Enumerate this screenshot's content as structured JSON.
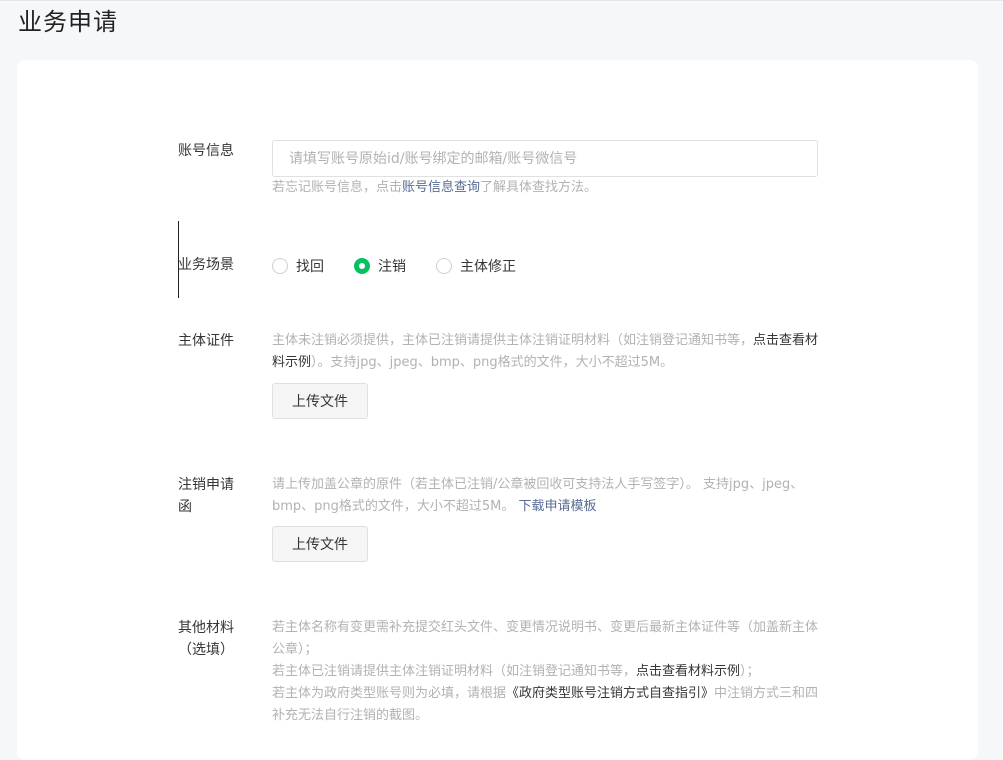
{
  "page": {
    "title": "业务申请"
  },
  "account": {
    "label": "账号信息",
    "placeholder": "请填写账号原始id/账号绑定的邮箱/账号微信号",
    "hint_pre": "若忘记账号信息，点击",
    "hint_link": "账号信息查询",
    "hint_post": "了解具体查找方法。"
  },
  "scene": {
    "label": "业务场景",
    "options": [
      "找回",
      "注销",
      "主体修正"
    ],
    "selected": "注销"
  },
  "cert": {
    "label": "主体证件",
    "desc_pre": "主体未注销必须提供，主体已注销请提供主体注销证明材料（如注销登记通知书等，",
    "desc_link": "点击查看材料示例",
    "desc_post": "）。支持jpg、jpeg、bmp、png格式的文件，大小不超过5M。",
    "upload_label": "上传文件"
  },
  "letter": {
    "label_line1": "注销申请",
    "label_line2": "函",
    "desc": "请上传加盖公章的原件（若主体已注销/公章被回收可支持法人手写签字）。 支持jpg、jpeg、bmp、png格式的文件，大小不超过5M。",
    "desc_link": "下载申请模板",
    "upload_label": "上传文件"
  },
  "other": {
    "label_line1": "其他材料",
    "label_line2": "（选填）",
    "line1": "若主体名称有变更需补充提交红头文件、变更情况说明书、变更后最新主体证件等（加盖新主体公章）；",
    "line2_pre": "若主体已注销请提供主体注销证明材料（如注销登记通知书等，",
    "line2_link": "点击查看材料示例",
    "line2_post": "）；",
    "line3_pre": "若主体为政府类型账号则为必填，请根据",
    "line3_link": "《政府类型账号注销方式自查指引》",
    "line3_post": "中注销方式三和四补充无法自行注销的截图。"
  }
}
